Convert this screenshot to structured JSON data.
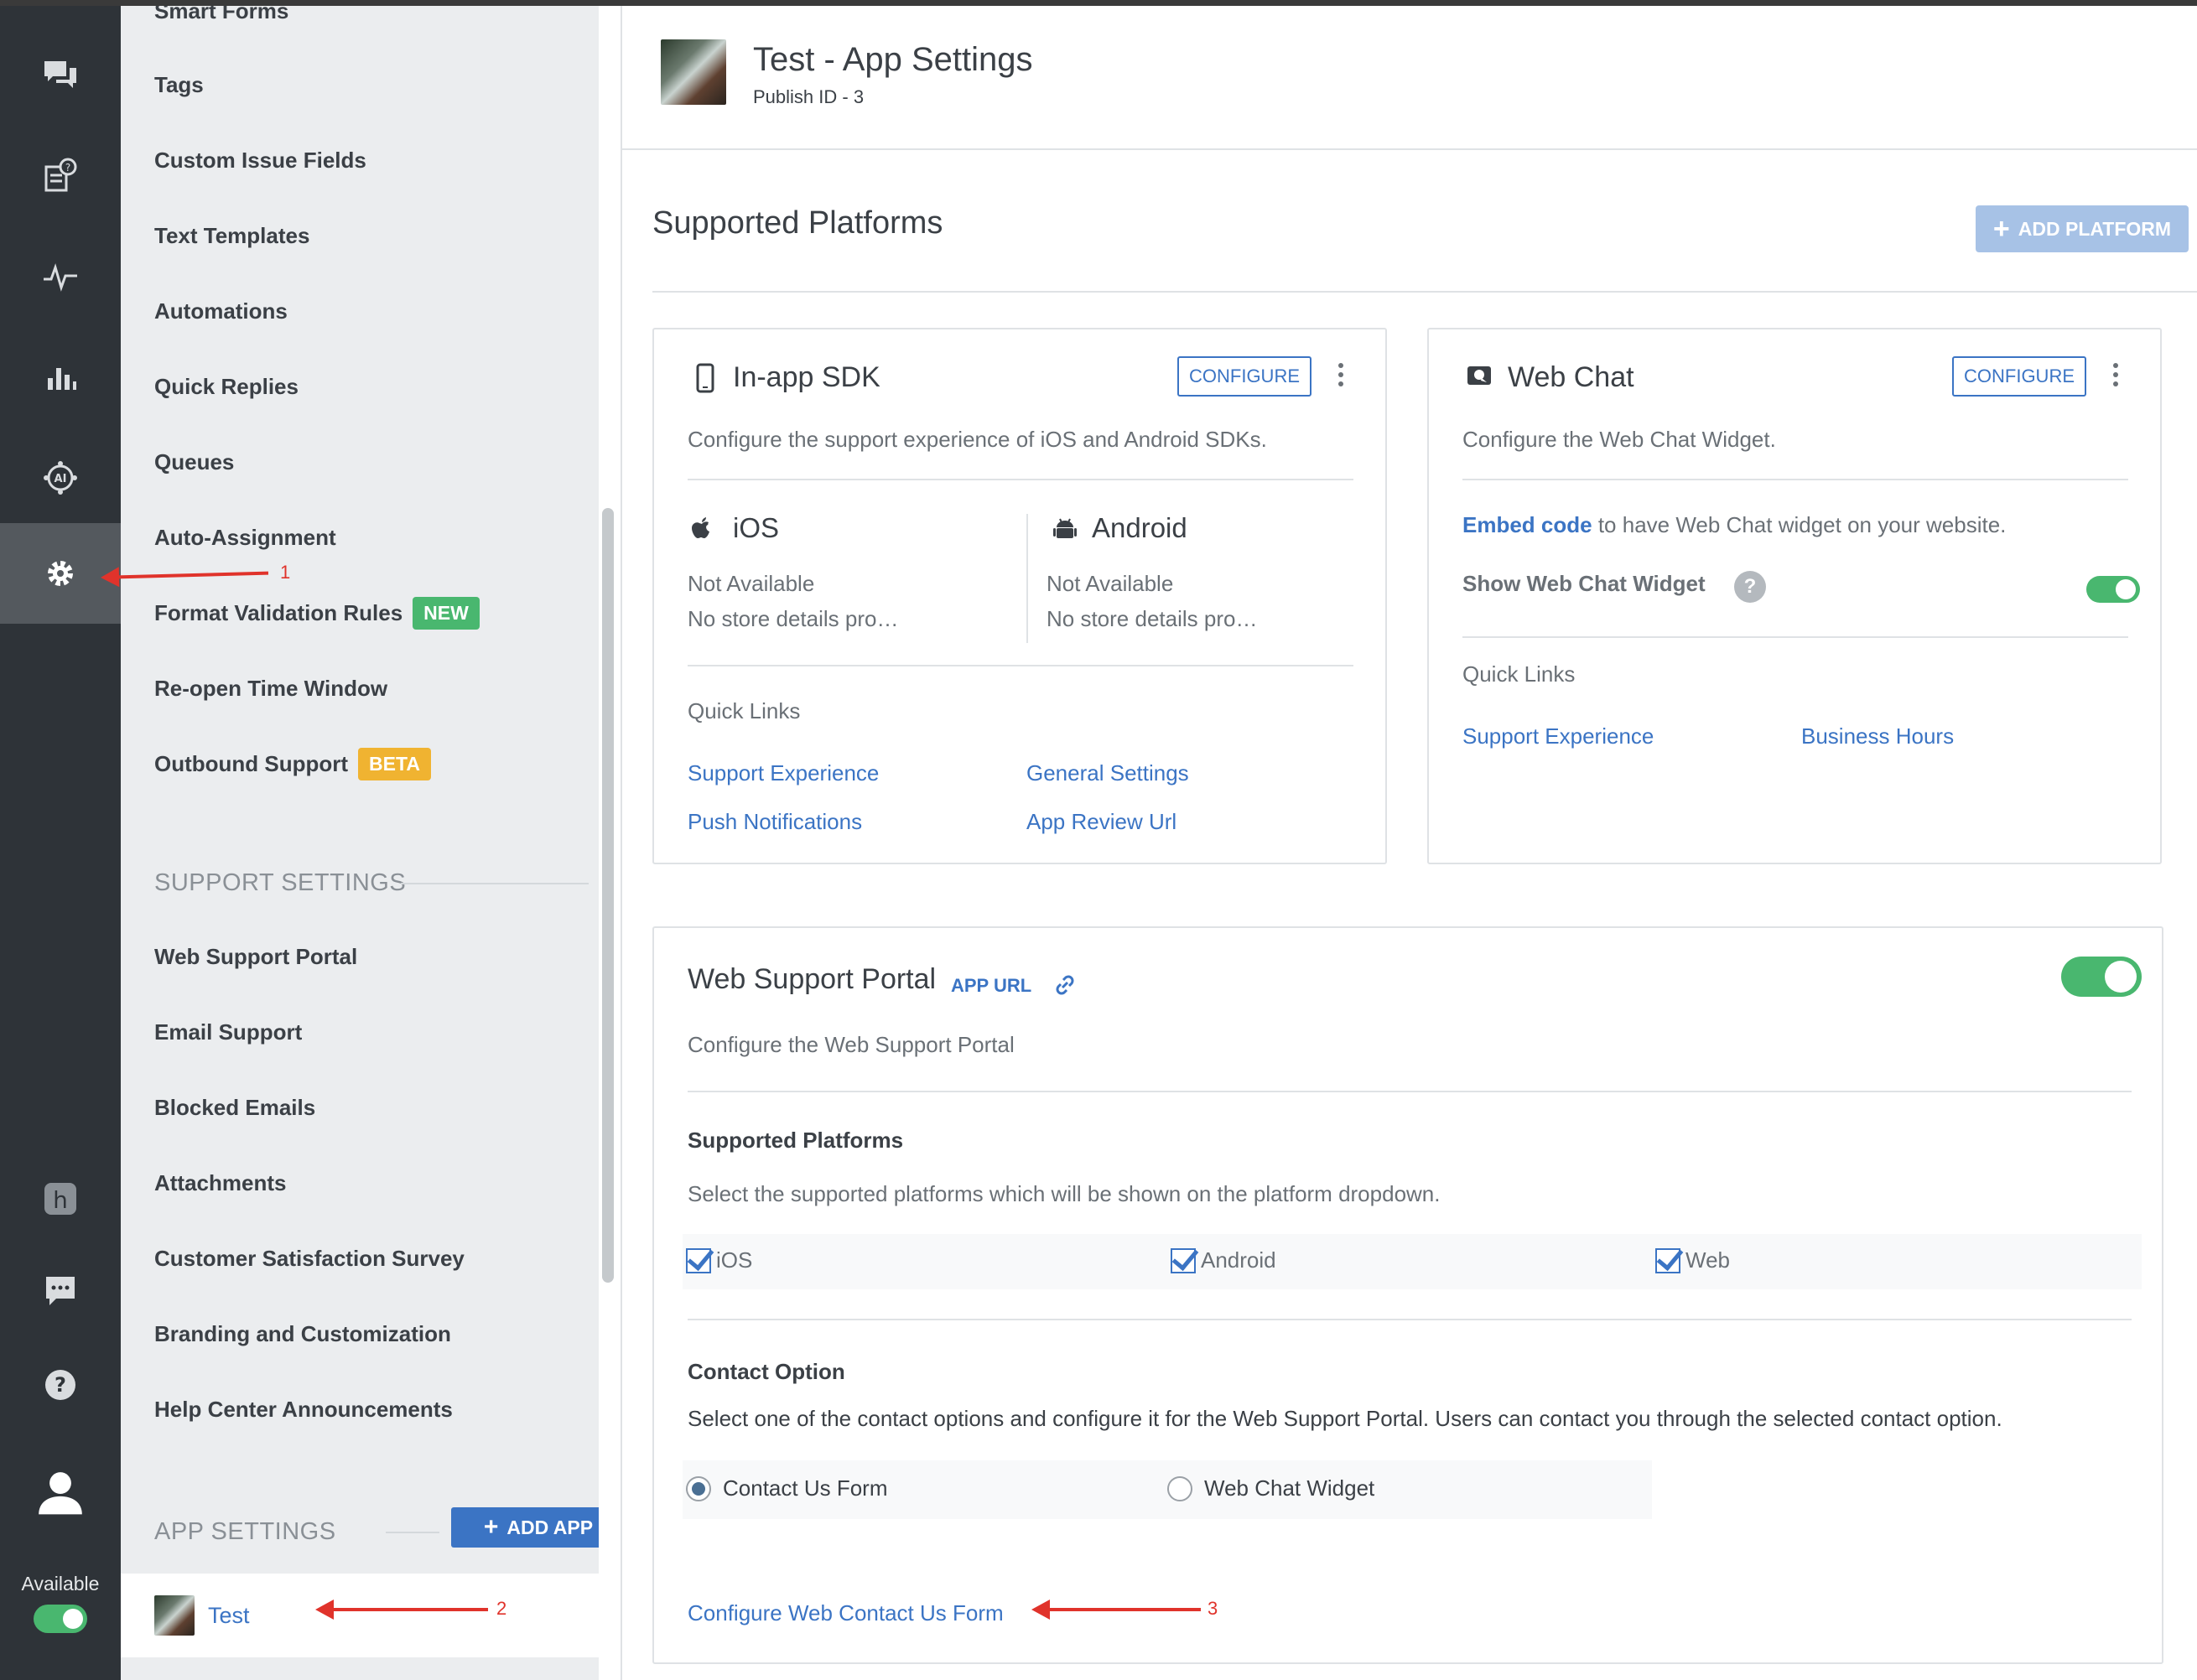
{
  "rail": {
    "icons": [
      "chat-icon",
      "faq-icon",
      "activity-icon",
      "analytics-icon",
      "ai-icon",
      "settings-icon",
      "helpshift-logo-icon",
      "message-icon",
      "help-icon",
      "user-avatar-icon"
    ],
    "status_label": "Available"
  },
  "sidebar": {
    "items": [
      {
        "label": "Smart Forms"
      },
      {
        "label": "Tags"
      },
      {
        "label": "Custom Issue Fields"
      },
      {
        "label": "Text Templates"
      },
      {
        "label": "Automations"
      },
      {
        "label": "Quick Replies"
      },
      {
        "label": "Queues"
      },
      {
        "label": "Auto-Assignment"
      },
      {
        "label": "Format Validation Rules",
        "badge": "NEW"
      },
      {
        "label": "Re-open Time Window"
      },
      {
        "label": "Outbound Support",
        "badge": "BETA"
      }
    ],
    "support_settings": {
      "heading": "SUPPORT SETTINGS",
      "items": [
        "Web Support Portal",
        "Email Support",
        "Blocked Emails",
        "Attachments",
        "Customer Satisfaction Survey",
        "Branding and Customization",
        "Help Center Announcements"
      ]
    },
    "app_settings": {
      "heading": "APP SETTINGS",
      "add_app_label": "ADD APP",
      "apps": [
        {
          "name": "Test"
        }
      ]
    }
  },
  "header": {
    "title": "Test - App Settings",
    "subtitle": "Publish ID - 3"
  },
  "platforms": {
    "title": "Supported Platforms",
    "add_platform_label": "ADD PLATFORM",
    "inapp": {
      "title": "In-app SDK",
      "configure_label": "CONFIGURE",
      "description": "Configure the support experience of iOS and Android SDKs.",
      "ios": {
        "title": "iOS",
        "status": "Not Available",
        "store": "No store details pro…"
      },
      "android": {
        "title": "Android",
        "status": "Not Available",
        "store": "No store details pro…"
      },
      "quick_links_label": "Quick Links",
      "links": [
        "Support Experience",
        "General Settings",
        "Push Notifications",
        "App Review Url"
      ]
    },
    "webchat": {
      "title": "Web Chat",
      "configure_label": "CONFIGURE",
      "description": "Configure the Web Chat Widget.",
      "embed_link": "Embed code",
      "embed_text": "to have Web Chat widget on your website.",
      "show_widget_label": "Show Web Chat Widget",
      "show_widget_enabled": true,
      "quick_links_label": "Quick Links",
      "links": [
        "Support Experience",
        "Business Hours"
      ]
    }
  },
  "portal": {
    "title": "Web Support Portal",
    "app_url_label": "APP URL",
    "enabled": true,
    "description": "Configure the Web Support Portal",
    "supported_platforms": {
      "heading": "Supported Platforms",
      "description": "Select the supported platforms which will be shown on the platform dropdown.",
      "options": [
        {
          "label": "iOS",
          "checked": true
        },
        {
          "label": "Android",
          "checked": true
        },
        {
          "label": "Web",
          "checked": true
        }
      ]
    },
    "contact_option": {
      "heading": "Contact Option",
      "description": "Select one of the contact options and configure it for the Web Support Portal. Users can contact you through the selected contact option.",
      "options": [
        {
          "label": "Contact Us Form",
          "selected": true
        },
        {
          "label": "Web Chat Widget",
          "selected": false
        }
      ],
      "configure_link": "Configure Web Contact Us Form"
    }
  },
  "annotations": [
    "1",
    "2",
    "3"
  ],
  "colors": {
    "rail_bg": "#2e3338",
    "sidebar_bg": "#ebedef",
    "link_blue": "#3b74c4",
    "toggle_green": "#49b76f",
    "badge_new": "#49b76f",
    "badge_beta": "#f0b331",
    "annotation_red": "#e0332b"
  }
}
